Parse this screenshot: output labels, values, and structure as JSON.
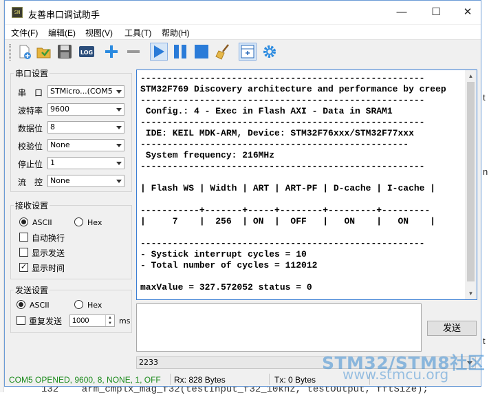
{
  "window": {
    "title": "友善串口调试助手",
    "app_icon_text": "SN",
    "controls": {
      "minimize": "—",
      "maximize": "☐",
      "close": "✕"
    }
  },
  "menu": [
    "文件(F)",
    "编辑(E)",
    "视图(V)",
    "工具(T)",
    "帮助(H)"
  ],
  "toolbar": {
    "icons": [
      "new-file-icon",
      "open-folder-icon",
      "save-icon",
      "log-icon",
      "plus-icon",
      "minus-icon",
      "play-icon",
      "pause-icon",
      "stop-icon",
      "broom-icon",
      "layout-icon",
      "gear-icon"
    ],
    "log_text": "LOG"
  },
  "serial": {
    "title": "串口设置",
    "rows": [
      {
        "label": "串　口",
        "value": "STMicro...(COM5"
      },
      {
        "label": "波特率",
        "value": "9600"
      },
      {
        "label": "数据位",
        "value": "8"
      },
      {
        "label": "校验位",
        "value": "None"
      },
      {
        "label": "停止位",
        "value": "1"
      },
      {
        "label": "流　控",
        "value": "None"
      }
    ]
  },
  "receive": {
    "title": "接收设置",
    "ascii": "ASCII",
    "hex": "Hex",
    "selected": "ASCII",
    "options": [
      {
        "label": "自动换行",
        "checked": false
      },
      {
        "label": "显示发送",
        "checked": false
      },
      {
        "label": "显示时间",
        "checked": true
      }
    ]
  },
  "send": {
    "title": "发送设置",
    "ascii": "ASCII",
    "hex": "Hex",
    "selected": "ASCII",
    "repeat_label": "重复发送",
    "repeat_checked": false,
    "interval": "1000",
    "unit": "ms",
    "button": "发送",
    "history": "2233"
  },
  "output_lines": [
    "-----------------------------------------------------",
    "STM32F769 Discovery architecture and performance by creep",
    "-----------------------------------------------------",
    " Config.: 4 - Exec in Flash AXI - Data in SRAM1",
    "-----------------------------------------------------",
    " IDE: KEIL MDK-ARM, Device: STM32F76xxx/STM32F77xxx",
    "--------------------------------------------------",
    " System frequency: 216MHz",
    "-----------------------------------------------------",
    "",
    "| Flash WS | Width | ART | ART-PF | D-cache | I-cache |",
    "",
    "-----------+-------+-----+--------+---------+---------",
    "|     7    |  256  | ON  |  OFF   |   ON    |   ON    |",
    "",
    "-----------------------------------------------------",
    "- Systick interrupt cycles = 10",
    "- Total number of cycles = 112012",
    "",
    "maxValue = 327.572052 status = 0"
  ],
  "status": {
    "port": "COM5 OPENED, 9600, 8, NONE, 1, OFF",
    "rx": "Rx: 828 Bytes",
    "tx": "Tx: 0 Bytes",
    "port_color": "#1a8a1a"
  },
  "watermark": {
    "line1": "STM32/STM8社区",
    "line2": "www.stmcu.org"
  },
  "background": {
    "code_line": "132    arm_cmplx_mag_f32(testInput_f32_10khz, testOutput, fftSize);",
    "right_marks": [
      "t",
      "n",
      "t"
    ]
  }
}
